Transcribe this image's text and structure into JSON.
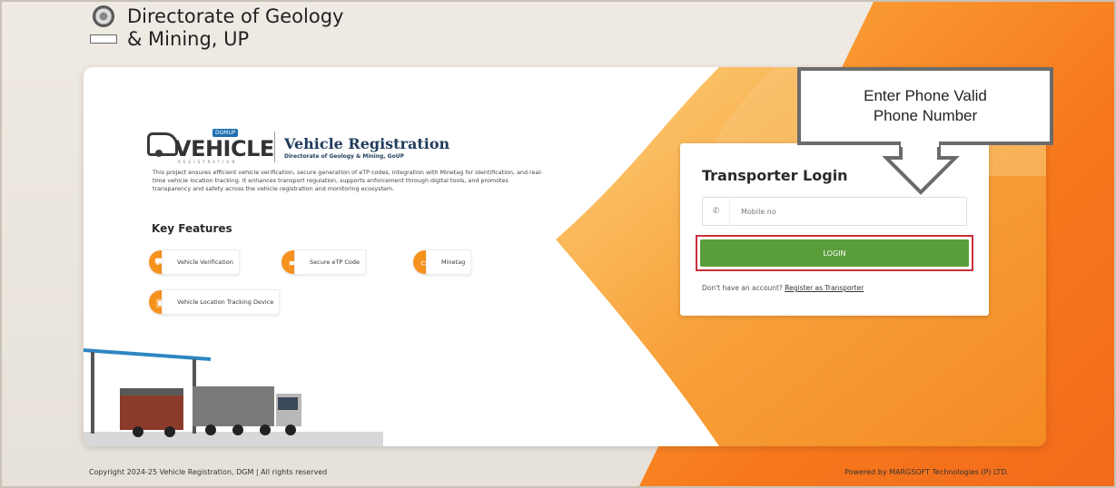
{
  "header": {
    "org_title_line1": "Directorate of Geology",
    "org_title_line2": "& Mining, UP"
  },
  "brand": {
    "logo_word": "VEHICLE",
    "logo_tag": "DGMUP",
    "logo_sub": "REGISTRATION",
    "title": "Vehicle Registration",
    "subtitle": "Directorate of Geology & Mining, GoUP"
  },
  "description": "This project ensures efficient vehicle verification, secure generation of eTP codes, integration with Minetag for identification, and real-time vehicle location tracking. It enhances transport regulation, supports enforcement through digital tools, and promotes transparency and safety across the vehicle registration and monitoring ecosystem.",
  "key_features": {
    "title": "Key Features",
    "items": [
      {
        "label": "Vehicle Verification",
        "icon": "truck-check-icon"
      },
      {
        "label": "Secure eTP Code",
        "icon": "card-icon"
      },
      {
        "label": "Minetag",
        "icon": "tag-icon"
      },
      {
        "label": "Vehicle Location Tracking Device",
        "icon": "tracking-device-icon"
      }
    ]
  },
  "login": {
    "title": "Transporter Login",
    "mobile_placeholder": "Mobile no",
    "login_button": "LOGIN",
    "register_prefix": "Don't have an account?",
    "register_link": "Register as Transporter"
  },
  "callout": {
    "line1": "Enter Phone Valid",
    "line2": "Phone Number"
  },
  "footer": {
    "copyright": "Copyright 2024-25 Vehicle Registration, DGM | All rights reserved",
    "powered_by": "Powered by MARGSOFT Technologies (P) LTD."
  },
  "colors": {
    "accent_orange": "#f7921e",
    "login_green": "#5a9e3b",
    "highlight_red": "#c8303a",
    "brand_blue": "#1f6fb2"
  }
}
